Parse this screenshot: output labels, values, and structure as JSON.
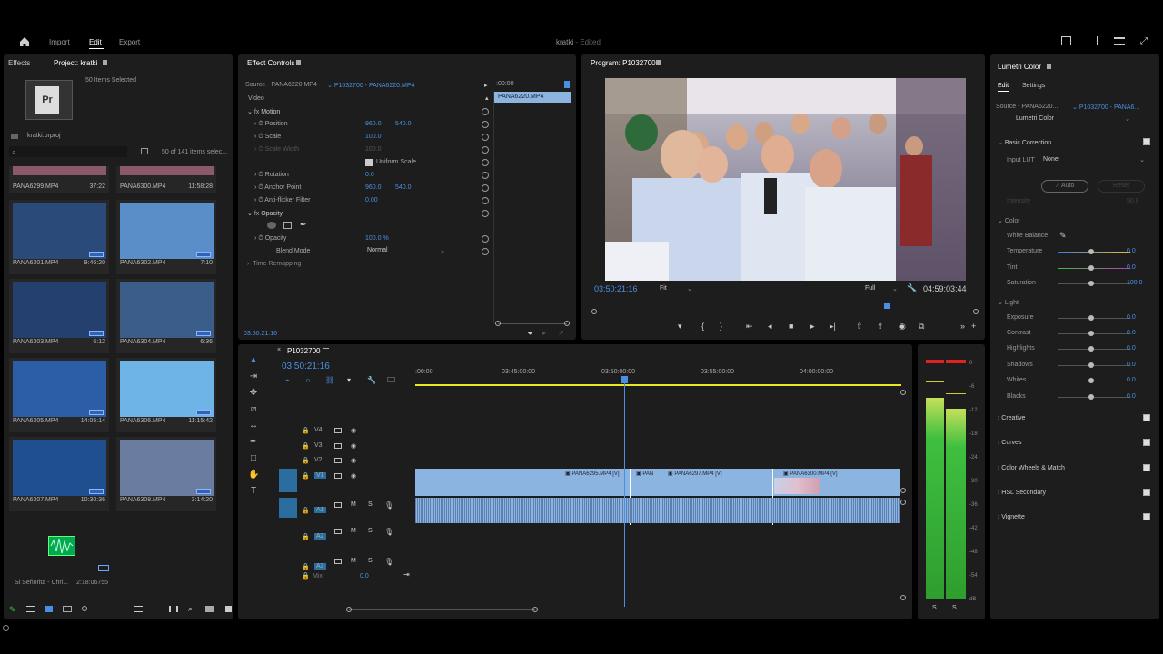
{
  "topnav": {
    "home": "⌂",
    "import": "Import",
    "edit": "Edit",
    "export": "Export",
    "title": "kratki",
    "edited": "- Edited"
  },
  "project": {
    "tab_effects": "Effects",
    "tab_project": "Project: kratki",
    "selected": "50 Items Selected",
    "file": "kratki.prproj",
    "count": "50 of 141 items selec...",
    "tiles": [
      {
        "name": "PANA6299.MP4",
        "dur": "37:22"
      },
      {
        "name": "PANA6300.MP4",
        "dur": "11:58:28"
      },
      {
        "name": "PANA6301.MP4",
        "dur": "9:46:20"
      },
      {
        "name": "PANA6302.MP4",
        "dur": "7:10"
      },
      {
        "name": "PANA6303.MP4",
        "dur": "6:12"
      },
      {
        "name": "PANA6304.MP4",
        "dur": "6:36"
      },
      {
        "name": "PANA6305.MP4",
        "dur": "14:05:14"
      },
      {
        "name": "PANA6306.MP4",
        "dur": "11:15:42"
      },
      {
        "name": "PANA6307.MP4",
        "dur": "10:30:36"
      },
      {
        "name": "PANA6308.MP4",
        "dur": "3:14:20"
      }
    ],
    "audio_name": "Si Señorita - Chri...",
    "audio_dur": "2:18:06755"
  },
  "effect_controls": {
    "title": "Effect Controls",
    "source": "Source - PANA6220.MP4",
    "clip": "P1032700 - PANA6220.MP4",
    "time_ruler": ":00:00",
    "clip_label": "PANA6220.MP4",
    "video": "Video",
    "motion": "Motion",
    "position": "Position",
    "pos_x": "960.0",
    "pos_y": "540.0",
    "scale": "Scale",
    "scale_v": "100.0",
    "scale_width": "Scale Width",
    "scale_width_v": "100.0",
    "uniform": "Uniform Scale",
    "rotation": "Rotation",
    "rotation_v": "0.0",
    "anchor": "Anchor Point",
    "anchor_x": "960.0",
    "anchor_y": "540.0",
    "antiflicker": "Anti-flicker Filter",
    "antiflicker_v": "0.00",
    "opacity": "Opacity",
    "opacity_row": "Opacity",
    "opacity_v": "100.0 %",
    "blend": "Blend Mode",
    "blend_v": "Normal",
    "time_remap": "Time Remapping",
    "timecode": "03:50:21:16"
  },
  "program": {
    "title": "Program: P1032700",
    "timecode": "03:50:21:16",
    "fit": "Fit",
    "full": "Full",
    "duration": "04:59:03:44"
  },
  "timeline": {
    "title": "P1032700",
    "timecode": "03:50:21:16",
    "ruler": [
      ":00:00",
      "03:45:00:00",
      "03:50:00:00",
      "03:55:00:00",
      "04:00:00:00"
    ],
    "tracks_v": [
      "V4",
      "V3",
      "V2",
      "V1"
    ],
    "tracks_a": [
      "A1",
      "A2",
      "A3"
    ],
    "mix": "Mix",
    "mix_v": "0.0",
    "clips": [
      "PANA6295.MP4 [V]",
      "PAN",
      "PANA6297.MP4 [V]",
      "PANA6300.MP4 [V]"
    ]
  },
  "meter": {
    "ticks": [
      "0",
      "-6",
      "-12",
      "-18",
      "-24",
      "-30",
      "-36",
      "-42",
      "-48",
      "-54",
      "dB"
    ],
    "s1": "S",
    "s2": "S"
  },
  "lumetri": {
    "title": "Lumetri Color",
    "tab_edit": "Edit",
    "tab_settings": "Settings",
    "source": "Source - PANA6220...",
    "clip": "P1032700 - PANA6...",
    "effect": "Lumetri Color",
    "basic": "Basic Correction",
    "input_lut": "Input LUT",
    "lut_v": "None",
    "auto": "Auto",
    "reset": "Reset",
    "intensity": "Intensity",
    "intensity_v": "50.0",
    "color": "Color",
    "wb": "White Balance",
    "temperature": "Temperature",
    "temperature_v": "0.0",
    "tint": "Tint",
    "tint_v": "0.0",
    "saturation": "Saturation",
    "saturation_v": "100.0",
    "light": "Light",
    "exposure": "Exposure",
    "exposure_v": "0.0",
    "contrast": "Contrast",
    "contrast_v": "0.0",
    "highlights": "Highlights",
    "highlights_v": "0.0",
    "shadows": "Shadows",
    "shadows_v": "0.0",
    "whites": "Whites",
    "whites_v": "0.0",
    "blacks": "Blacks",
    "blacks_v": "0.0",
    "creative": "Creative",
    "curves": "Curves",
    "wheels": "Color Wheels & Match",
    "hsl": "HSL Secondary",
    "vignette": "Vignette"
  },
  "colors": {
    "accent": "#4a90e2",
    "clip": "#8bb4e0",
    "meter": "#3fbf3f"
  }
}
